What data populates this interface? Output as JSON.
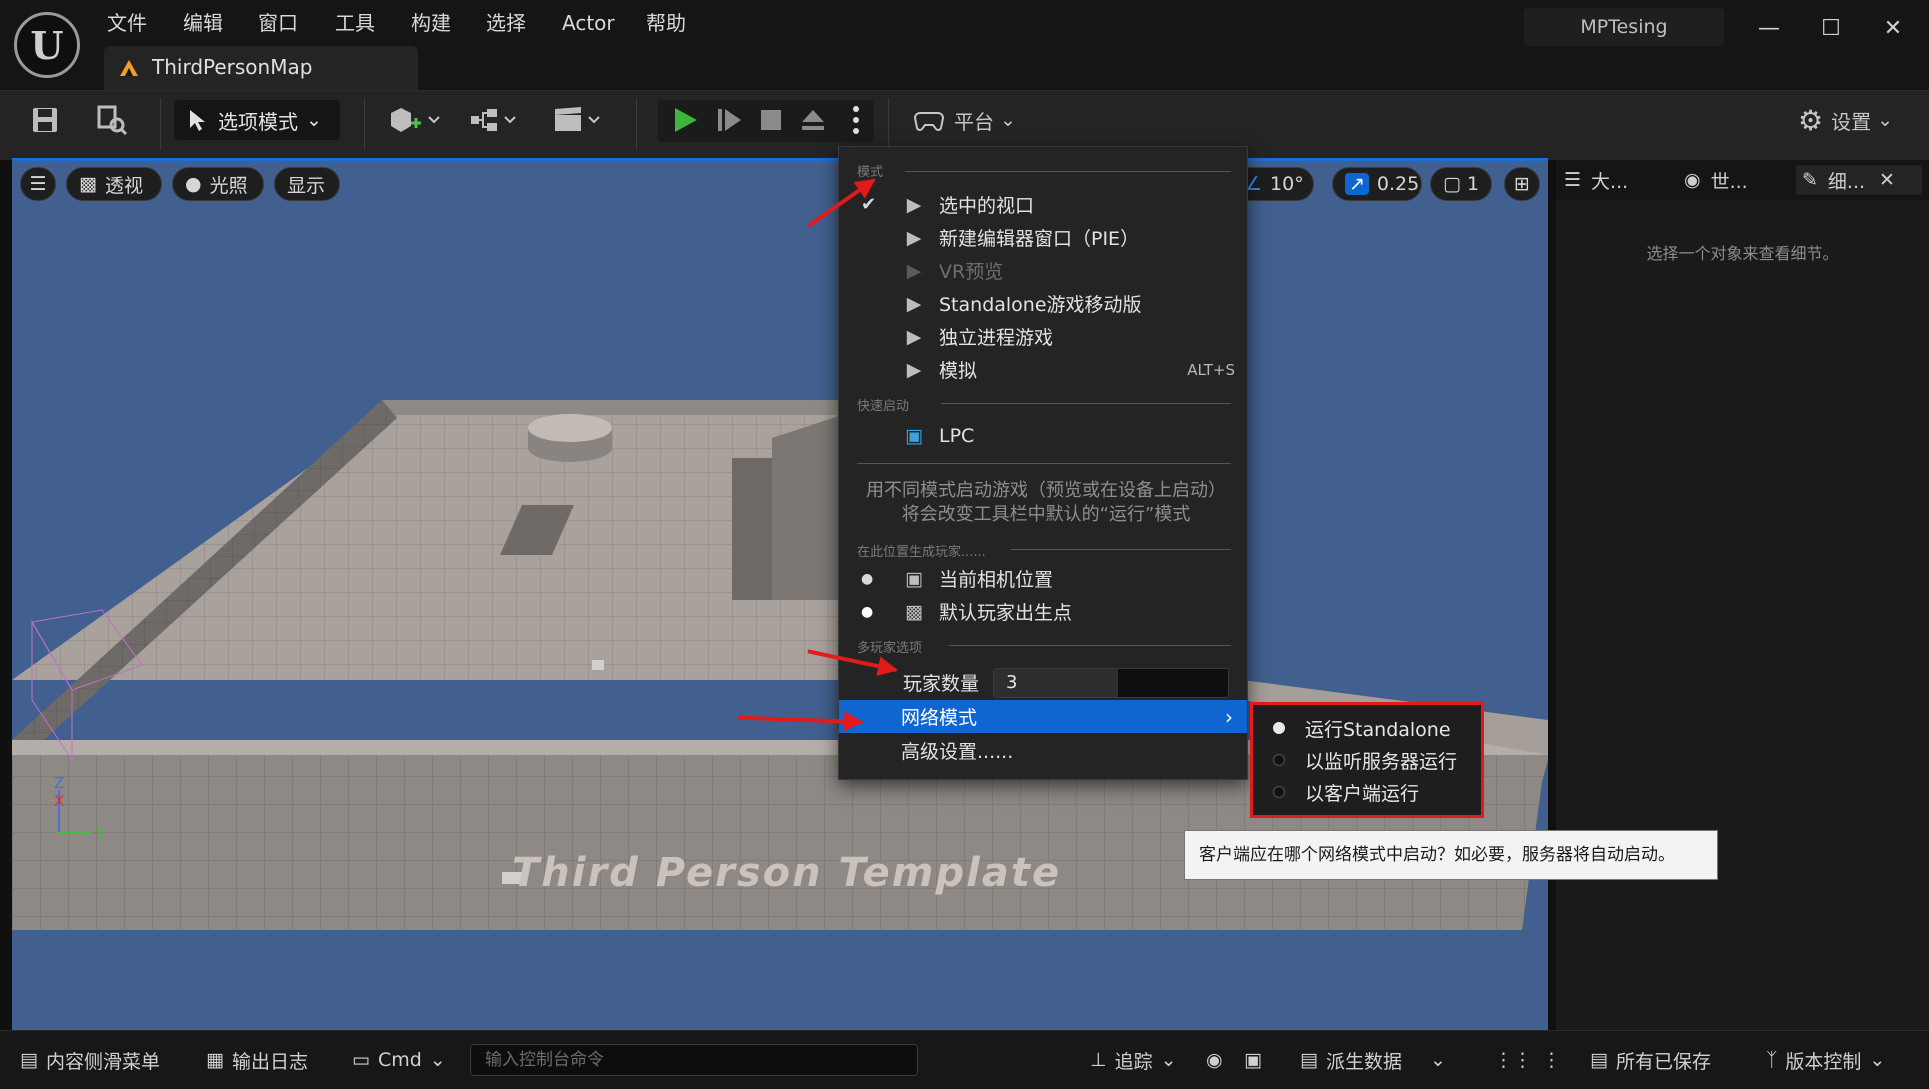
{
  "window": {
    "project_name": "MPTesing",
    "tab_title": "ThirdPersonMap"
  },
  "menu": [
    "文件",
    "编辑",
    "窗口",
    "工具",
    "构建",
    "选择",
    "Actor",
    "帮助"
  ],
  "toolbar": {
    "mode_label": "选项模式",
    "platform_label": "平台",
    "settings_label": "设置"
  },
  "viewport": {
    "perspective_label": "透视",
    "lighting_label": "光照",
    "show_label": "显示",
    "rotation_snap": "10°",
    "scale_snap": "0.25",
    "camera_speed": "1",
    "watermark": "Third Person Template",
    "axis_z": "Z",
    "axis_x": "X",
    "axis_y": "Y"
  },
  "right_panel": {
    "tabs": [
      "大...",
      "世...",
      "细..."
    ],
    "hint": "选择一个对象来查看细节。"
  },
  "play_menu": {
    "section_mode": "模式",
    "items_mode": [
      {
        "label": "选中的视口",
        "checked": true
      },
      {
        "label": "新建编辑器窗口（PIE）"
      },
      {
        "label": "VR预览",
        "disabled": true
      },
      {
        "label": "Standalone游戏移动版"
      },
      {
        "label": "独立进程游戏"
      },
      {
        "label": "模拟",
        "shortcut": "ALT+S"
      }
    ],
    "section_quick": "快速启动",
    "quick_item": "LPC",
    "description": "用不同模式启动游戏（预览或在设备上启动）将会改变工具栏中默认的“运行”模式",
    "section_spawn": "在此位置生成玩家......",
    "spawn_items": [
      "当前相机位置",
      "默认玩家出生点"
    ],
    "section_multi": "多玩家选项",
    "players_label": "玩家数量",
    "players_value": "3",
    "players_fill": 0.53,
    "net_mode_label": "网络模式",
    "advanced_label": "高级设置......"
  },
  "net_submenu": {
    "items": [
      {
        "label": "运行Standalone",
        "selected": true
      },
      {
        "label": "以监听服务器运行"
      },
      {
        "label": "以客户端运行"
      }
    ]
  },
  "tooltip": "客户端应在哪个网络模式中启动？如必要，服务器将自动启动。",
  "bottom": {
    "content_drawer": "内容侧滑菜单",
    "output_log": "输出日志",
    "cmd": "Cmd",
    "console_placeholder": "输入控制台命令",
    "trace": "追踪",
    "derived_data": "派生数据",
    "all_saved": "所有已保存",
    "source_control": "版本控制"
  },
  "colors": {
    "accent": "#0f66d0",
    "annotation_red": "#e11b1b",
    "viewport_sky": "#41608f"
  }
}
